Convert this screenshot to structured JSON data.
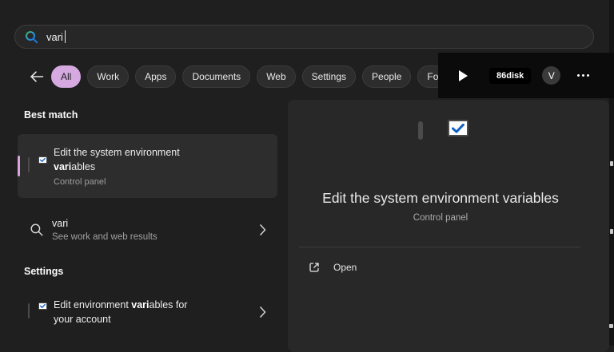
{
  "colors": {
    "accent_purple": "#d6a9e1",
    "window_bg": "#1f1f1f",
    "card_bg": "#282828",
    "selected_item_bg": "#2d2d2d",
    "overlay_bg": "#0b0b0b",
    "monitor_blue_light": "#45d3f2",
    "monitor_blue_dark": "#0a5dc4",
    "check_blue": "#1463c4"
  },
  "search": {
    "query": "vari",
    "icon": "search-icon"
  },
  "filters": {
    "items": [
      "All",
      "Work",
      "Apps",
      "Documents",
      "Web",
      "Settings",
      "People",
      "Folders"
    ],
    "active": "All"
  },
  "account_bar": {
    "play_icon": "play-icon",
    "badge": "86disk",
    "avatar_initial": "V",
    "more_icon": "ellipsis-icon"
  },
  "results": {
    "best_match_header": "Best match",
    "best_match": {
      "line1": "Edit the system environment",
      "line2_bold": "vari",
      "line2_rest": "ables",
      "subtitle": "Control panel",
      "icon": "system-properties-icon"
    },
    "web_suggestion": {
      "query": "vari",
      "subtitle": "See work and web results",
      "icon": "search-outline-icon"
    },
    "settings_header": "Settings",
    "settings_item": {
      "line1_pre": "Edit environment ",
      "line1_bold": "vari",
      "line1_rest": "ables for",
      "line2": "your account",
      "icon": "system-properties-icon"
    }
  },
  "preview": {
    "title": "Edit the system environment variables",
    "subtitle": "Control panel",
    "icon": "system-properties-icon",
    "open_label": "Open"
  }
}
